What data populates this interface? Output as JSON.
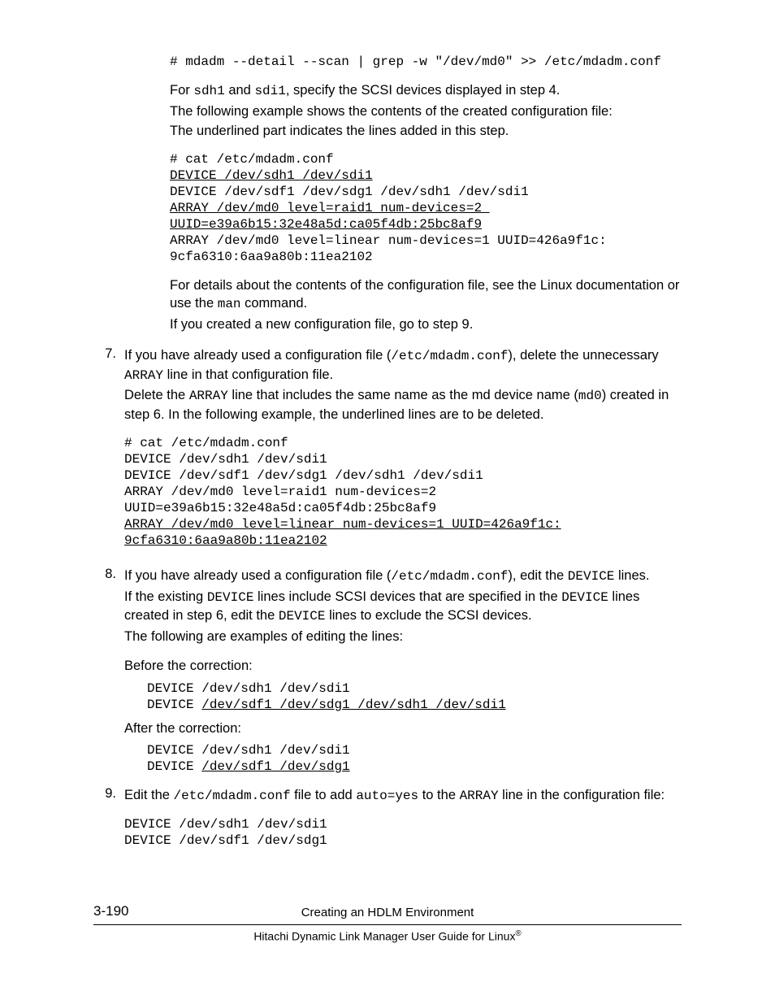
{
  "intro": {
    "cmd": "# mdadm --detail --scan | grep -w \"/dev/md0\" >> /etc/mdadm.conf",
    "p_pre": "For ",
    "c1": "sdh1",
    "p_and": " and ",
    "c2": "sdi1",
    "p_post": ", specify the SCSI devices displayed in step 4.",
    "p2": "The following example shows the contents of the created configuration file:",
    "p3": "The underlined part indicates the lines added in this step.",
    "block": {
      "l1": "# cat /etc/mdadm.conf",
      "l2": "DEVICE /dev/sdh1 /dev/sdi1",
      "l3": "DEVICE /dev/sdf1 /dev/sdg1 /dev/sdh1 /dev/sdi1",
      "l4": "ARRAY /dev/md0 level=raid1 num-devices=2 ",
      "l5": "UUID=e39a6b15:32e48a5d:ca05f4db:25bc8af9",
      "l6": "ARRAY /dev/md0 level=linear num-devices=1 UUID=426a9f1c:",
      "l7": "9cfa6310:6aa9a80b:11ea2102"
    },
    "p4a": "For details about the contents of the configuration file, see the Linux documentation or use the ",
    "c3": "man",
    "p4b": " command.",
    "p5": "If you created a new configuration file, go to step 9."
  },
  "s7": {
    "num": "7.",
    "p1a": "If you have already used a configuration file (",
    "c1": "/etc/mdadm.conf",
    "p1b": "), delete the unnecessary ",
    "c2": "ARRAY",
    "p1c": " line in that configuration file.",
    "p2a": "Delete the ",
    "c3": "ARRAY",
    "p2b": " line that includes the same name as the md device name (",
    "c4": "md0",
    "p2c": ") created in step 6. In the following example, the underlined lines are to be deleted.",
    "block": {
      "l1": "# cat /etc/mdadm.conf",
      "l2": "DEVICE /dev/sdh1 /dev/sdi1",
      "l3": "DEVICE /dev/sdf1 /dev/sdg1 /dev/sdh1 /dev/sdi1",
      "l4": "ARRAY /dev/md0 level=raid1 num-devices=2 ",
      "l5": "UUID=e39a6b15:32e48a5d:ca05f4db:25bc8af9",
      "l6": "ARRAY /dev/md0 level=linear num-devices=1 UUID=426a9f1c:",
      "l7": "9cfa6310:6aa9a80b:11ea2102"
    }
  },
  "s8": {
    "num": "8.",
    "p1a": "If you have already used a configuration file (",
    "c1": "/etc/mdadm.conf",
    "p1b": "), edit the ",
    "c2": "DEVICE",
    "p1c": " lines.",
    "p2a": "If the existing ",
    "c3": "DEVICE",
    "p2b": " lines include SCSI devices that are specified in the ",
    "c4": "DEVICE",
    "p2c": " lines created in step 6, edit the ",
    "c5": "DEVICE",
    "p2d": " lines to exclude the SCSI devices.",
    "p3": "The following are examples of editing the lines:",
    "before_label": "Before the correction:",
    "before": {
      "l1": "DEVICE /dev/sdh1 /dev/sdi1",
      "l2a": "DEVICE ",
      "l2b": "/dev/sdf1 /dev/sdg1 /dev/sdh1 /dev/sdi1"
    },
    "after_label": "After the correction:",
    "after": {
      "l1": "DEVICE /dev/sdh1 /dev/sdi1",
      "l2a": "DEVICE ",
      "l2b": "/dev/sdf1 /dev/sdg1"
    }
  },
  "s9": {
    "num": "9.",
    "p1a": "Edit the ",
    "c1": "/etc/mdadm.conf",
    "p1b": " file to add ",
    "c2": "auto=yes",
    "p1c": " to the ",
    "c3": "ARRAY",
    "p1d": " line in the configuration file:",
    "block": {
      "l1": "DEVICE /dev/sdh1 /dev/sdi1",
      "l2": "DEVICE /dev/sdf1 /dev/sdg1"
    }
  },
  "footer": {
    "page_num": "3-190",
    "chapter": "Creating an HDLM Environment",
    "doc_pre": "Hitachi Dynamic Link Manager User Guide for Linux",
    "reg": "®"
  }
}
